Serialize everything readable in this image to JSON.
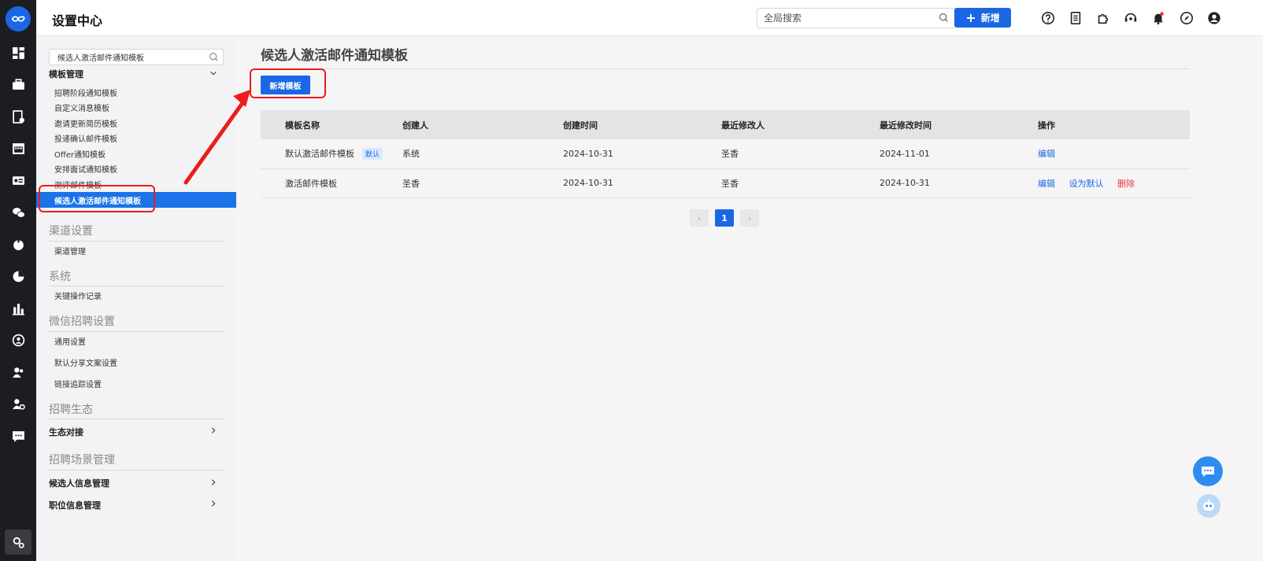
{
  "header": {
    "title": "设置中心",
    "search_placeholder": "全局搜索",
    "new_label": "新增"
  },
  "rail": {
    "icons": [
      "dashboard-icon",
      "briefcase-icon",
      "document-check-icon",
      "calendar-icon",
      "id-card-icon",
      "wechat-icon",
      "apple-icon",
      "pie-chart-icon",
      "bar-chart-icon",
      "person-badge-icon",
      "user-group-icon",
      "user-settings-icon",
      "message-icon",
      "settings-icon"
    ]
  },
  "sidebar": {
    "search_value": "候选人激活邮件通知模板",
    "group_template": "模板管理",
    "template_items": [
      "招聘阶段通知模板",
      "自定义消息模板",
      "邀请更新简历模板",
      "投递确认邮件模板",
      "Offer通知模板",
      "安排面试通知模板",
      "测评邮件模板"
    ],
    "active_item": "候选人激活邮件通知模板",
    "section_channel": "渠道设置",
    "channel_items": [
      "渠道管理"
    ],
    "section_system": "系统",
    "system_items": [
      "关键操作记录"
    ],
    "section_wechat": "微信招聘设置",
    "wechat_items": [
      "通用设置",
      "默认分享文案设置",
      "链接追踪设置"
    ],
    "section_eco": "招聘生态",
    "eco_group": "生态对接",
    "section_scene": "招聘场景管理",
    "scene_groups": [
      "候选人信息管理",
      "职位信息管理"
    ]
  },
  "main": {
    "page_title": "候选人激活邮件通知模板",
    "add_template_label": "新增模板",
    "columns": [
      "模板名称",
      "创建人",
      "创建时间",
      "最近修改人",
      "最近修改时间",
      "操作"
    ],
    "rows": [
      {
        "name": "默认激活邮件模板",
        "badge": "默认",
        "creator": "系统",
        "created": "2024-10-31",
        "modifier": "圣香",
        "modified": "2024-11-01",
        "actions": [
          "编辑"
        ]
      },
      {
        "name": "激活邮件模板",
        "badge": "",
        "creator": "圣香",
        "created": "2024-10-31",
        "modifier": "圣香",
        "modified": "2024-10-31",
        "actions": [
          "编辑",
          "设为默认",
          "删除"
        ]
      }
    ],
    "pagination": {
      "current_page": "1",
      "prev": "‹",
      "next": "›"
    }
  },
  "colors": {
    "accent": "#1a67e6",
    "active_bg": "#1a73e8",
    "danger": "#e53935",
    "annotation": "#ee1c1c",
    "rail_bg": "#1c1d20"
  }
}
